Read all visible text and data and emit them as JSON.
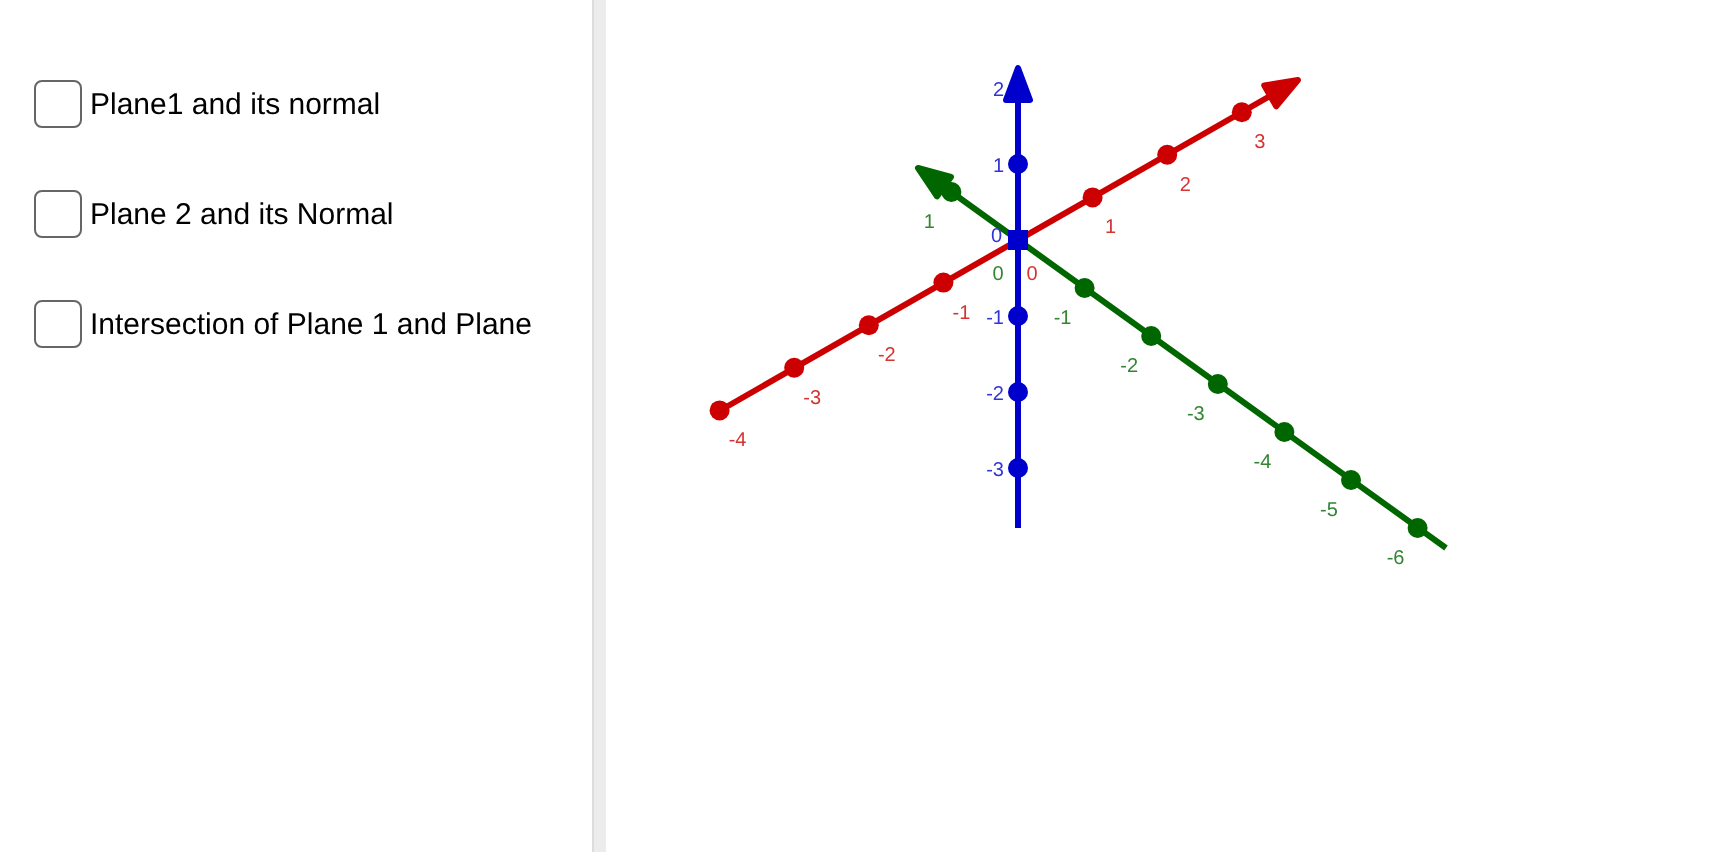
{
  "checkboxes": [
    {
      "label": "Plane1 and its normal",
      "checked": false
    },
    {
      "label": "Plane 2 and its Normal",
      "checked": false
    },
    {
      "label": "Intersection of Plane 1 and Plane",
      "checked": false
    }
  ],
  "axes": [
    {
      "kind": "x",
      "color": "#cc0000",
      "ticks": [
        "-4",
        "-3",
        "-2",
        "-1",
        "0",
        "1",
        "2",
        "3"
      ]
    },
    {
      "kind": "y",
      "color": "#006600",
      "ticks": [
        "1",
        "0",
        "-1",
        "-2",
        "-3",
        "-4",
        "-5",
        "-6"
      ]
    },
    {
      "kind": "z",
      "color": "#0000cc",
      "ticks": [
        "2",
        "1",
        "0",
        "-1",
        "-2",
        "-3"
      ]
    }
  ]
}
